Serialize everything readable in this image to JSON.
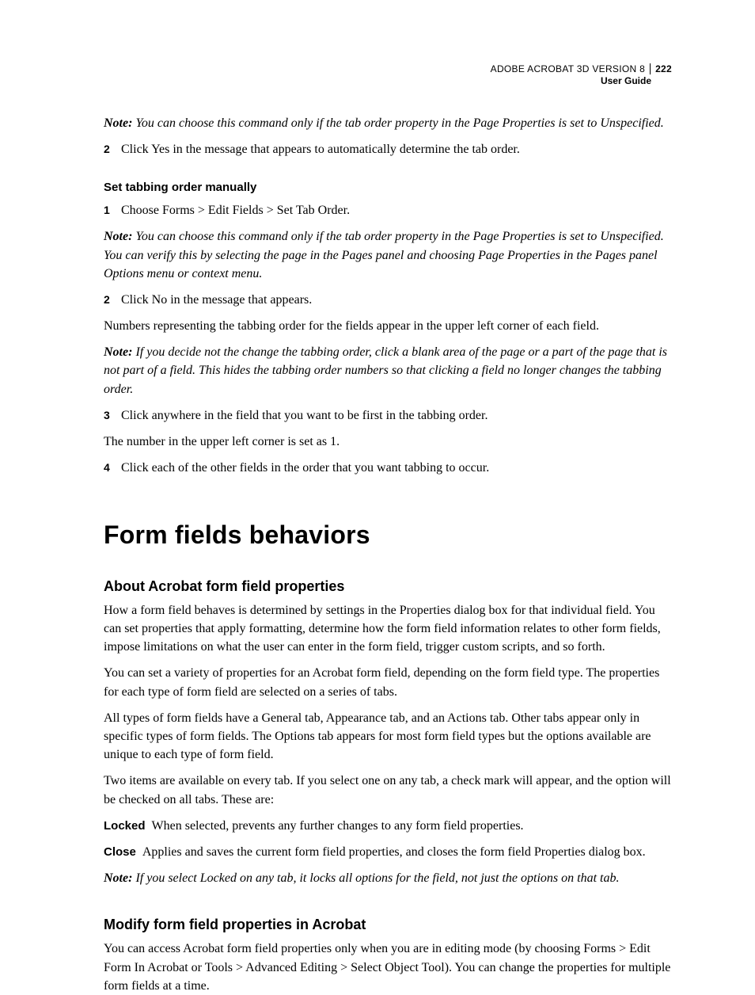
{
  "header": {
    "product": "ADOBE ACROBAT 3D VERSION 8",
    "doc": "User Guide",
    "page_number": "222"
  },
  "intro": {
    "note1_label": "Note:",
    "note1_body": " You can choose this command only if the tab order property in the Page Properties is set to Unspecified.",
    "step2_num": "2",
    "step2_text": "Click Yes in the message that appears to automatically determine the tab order."
  },
  "manual": {
    "heading": "Set tabbing order manually",
    "step1_num": "1",
    "step1_text": "Choose Forms > Edit Fields > Set Tab Order.",
    "note_label": "Note:",
    "note_body": " You can choose this command only if the tab order property in the Page Properties is set to Unspecified. You can verify this by selecting the page in the Pages panel and choosing Page Properties in the Pages panel Options menu or context menu.",
    "step2_num": "2",
    "step2_text": "Click No in the message that appears.",
    "after2": "Numbers representing the tabbing order for the fields appear in the upper left corner of each field.",
    "note2_label": "Note:",
    "note2_body": " If you decide not the change the tabbing order, click a blank area of the page or a part of the page that is not part of a field. This hides the tabbing order numbers so that clicking a field no longer changes the tabbing order.",
    "step3_num": "3",
    "step3_text": "Click anywhere in the field that you want to be first in the tabbing order.",
    "after3": "The number in the upper left corner is set as 1.",
    "step4_num": "4",
    "step4_text": "Click each of the other fields in the order that you want tabbing to occur."
  },
  "section": {
    "title": "Form fields behaviors"
  },
  "about": {
    "heading": "About Acrobat form field properties",
    "p1": "How a form field behaves is determined by settings in the Properties dialog box for that individual field. You can set properties that apply formatting, determine how the form field information relates to other form fields, impose limitations on what the user can enter in the form field, trigger custom scripts, and so forth.",
    "p2": "You can set a variety of properties for an Acrobat form field, depending on the form field type. The properties for each type of form field are selected on a series of tabs.",
    "p3": "All types of form fields have a General tab, Appearance tab, and an Actions tab. Other tabs appear only in specific types of form fields. The Options tab appears for most form field types but the options available are unique to each type of form field.",
    "p4": "Two items are available on every tab. If you select one on any tab, a check mark will appear, and the option will be checked on all tabs. These are:",
    "locked_term": "Locked",
    "locked_def": "When selected, prevents any further changes to any form field properties.",
    "close_term": "Close",
    "close_def": "Applies and saves the current form field properties, and closes the form field Properties dialog box.",
    "note_label": "Note:",
    "note_body": " If you select Locked on any tab, it locks all options for the field, not just the options on that tab."
  },
  "modify": {
    "heading": "Modify form field properties in Acrobat",
    "p1": "You can access Acrobat form field properties only when you are in editing mode (by choosing Forms > Edit Form In Acrobat or Tools > Advanced Editing > Select Object Tool). You can change the properties for multiple form fields at a time."
  }
}
